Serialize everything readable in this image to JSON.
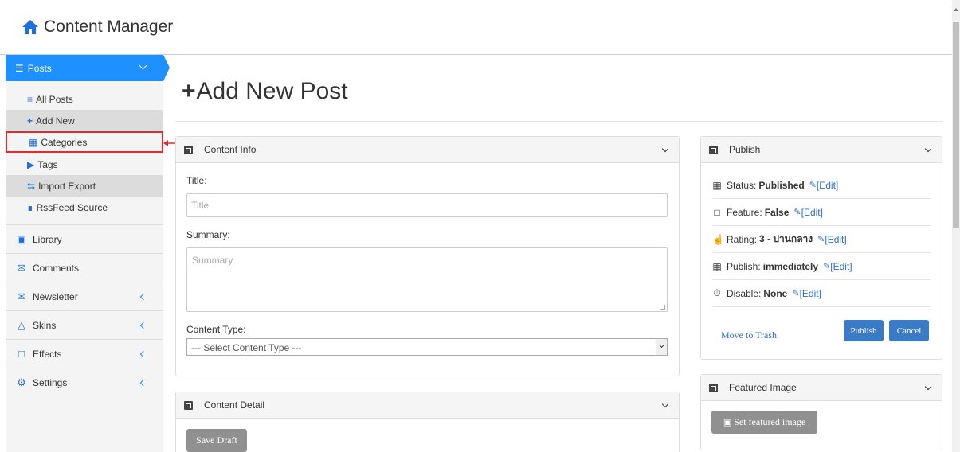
{
  "app": {
    "title": "Content Manager"
  },
  "sidebar": {
    "active": {
      "label": "Posts"
    },
    "subitems": [
      {
        "label": "All Posts",
        "icon": "list-icon"
      },
      {
        "label": "Add New",
        "icon": "plus-icon"
      },
      {
        "label": "Categories",
        "icon": "sitemap-icon"
      },
      {
        "label": "Tags",
        "icon": "tag-icon"
      },
      {
        "label": "Import Export",
        "icon": "exchange-icon"
      },
      {
        "label": "RssFeed Source",
        "icon": "rss-icon"
      }
    ],
    "menu": [
      {
        "label": "Library",
        "icon": "image-icon"
      },
      {
        "label": "Comments",
        "icon": "comments-icon"
      },
      {
        "label": "Newsletter",
        "icon": "envelope-icon"
      },
      {
        "label": "Skins",
        "icon": "shirt-icon"
      },
      {
        "label": "Effects",
        "icon": "effects-icon"
      },
      {
        "label": "Settings",
        "icon": "gear-icon"
      }
    ]
  },
  "main": {
    "page_title": "Add New Post",
    "content_info": {
      "header": "Content Info",
      "title_label": "Title:",
      "title_placeholder": "Title",
      "summary_label": "Summary:",
      "summary_placeholder": "Summary",
      "content_type_label": "Content Type:",
      "content_type_value": "--- Select Content Type ---"
    },
    "content_detail": {
      "header": "Content Detail",
      "save_draft": "Save Draft"
    },
    "publish": {
      "header": "Publish",
      "rows": [
        {
          "label": "Status:",
          "value": "Published",
          "edit": "[Edit]",
          "icon": "grid-icon"
        },
        {
          "label": "Feature:",
          "value": "False",
          "edit": "[Edit]",
          "icon": "clipboard-icon"
        },
        {
          "label": "Rating:",
          "value": "3 - ปานกลาง",
          "edit": "[Edit]",
          "icon": "thumbs-up-icon"
        },
        {
          "label": "Publish:",
          "value": "immediately",
          "edit": "[Edit]",
          "icon": "calendar-icon"
        },
        {
          "label": "Disable:",
          "value": "None",
          "edit": "[Edit]",
          "icon": "stopwatch-icon"
        }
      ],
      "move_to_trash": "Move to Trash",
      "publish_button": "Publish",
      "cancel_button": "Cancel"
    },
    "featured_image": {
      "header": "Featured Image",
      "set_button": "Set featured image"
    }
  },
  "colors": {
    "accent": "#1e90ff",
    "highlight": "#e8262c",
    "button_blue": "#3a7bc8"
  }
}
